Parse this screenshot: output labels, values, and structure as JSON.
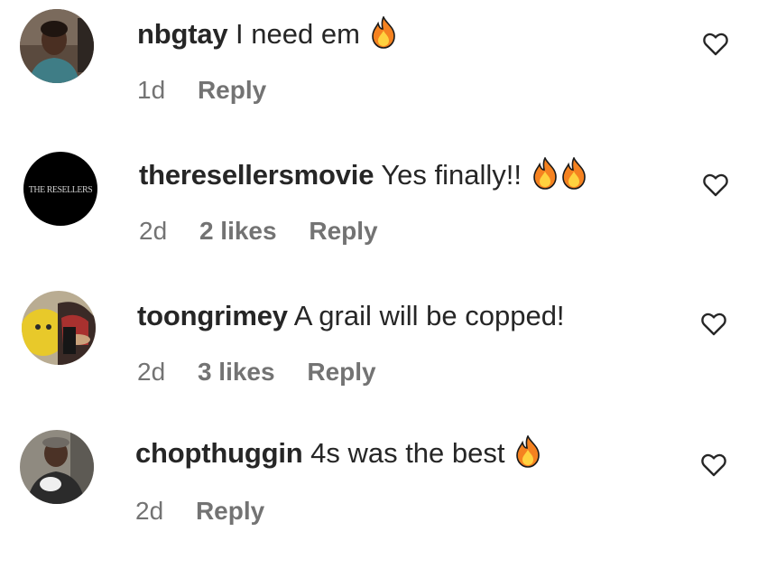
{
  "comments": [
    {
      "username": "nbgtay",
      "text": "I need em",
      "emojis": [
        "fire-emoji"
      ],
      "time": "1d",
      "likes": "",
      "reply_label": "Reply",
      "liked": false
    },
    {
      "username": "theresellersmovie",
      "text": "Yes finally!!",
      "emojis": [
        "fire-emoji",
        "fire-emoji"
      ],
      "time": "2d",
      "likes": "2 likes",
      "reply_label": "Reply",
      "liked": false,
      "avatar_text": "THE RESELLERS"
    },
    {
      "username": "toongrimey",
      "text": "A grail will be copped!",
      "emojis": [],
      "time": "2d",
      "likes": "3 likes",
      "reply_label": "Reply",
      "liked": false
    },
    {
      "username": "chopthuggin",
      "text": "4s was the best",
      "emojis": [
        "fire-emoji"
      ],
      "time": "2d",
      "likes": "",
      "reply_label": "Reply",
      "liked": false
    }
  ],
  "colors": {
    "text": "#262626",
    "secondary_text": "#737373",
    "fire_outer": "#f58220",
    "fire_inner": "#ffd23f"
  }
}
